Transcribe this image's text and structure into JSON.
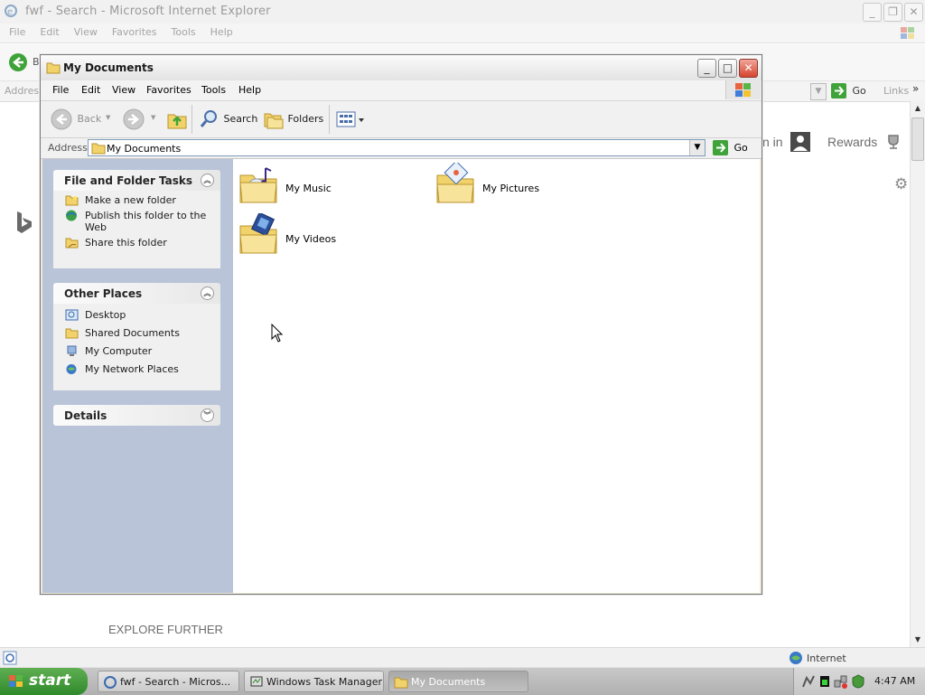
{
  "ie": {
    "title": "fwf - Search - Microsoft Internet Explorer",
    "menu": [
      "File",
      "Edit",
      "View",
      "Favorites",
      "Tools",
      "Help"
    ],
    "back_label": "B",
    "address_label": "Address",
    "go_label": "Go",
    "links_label": "Links",
    "sign_in_text": "n in",
    "rewards_text": "Rewards",
    "explore_text": "EXPLORE FURTHER",
    "status_zone": "Internet"
  },
  "window": {
    "title": "My Documents",
    "menu": [
      "File",
      "Edit",
      "View",
      "Favorites",
      "Tools",
      "Help"
    ],
    "toolbar": {
      "back": "Back",
      "search": "Search",
      "folders": "Folders"
    },
    "address_label": "Address",
    "address_value": "My Documents",
    "go_label": "Go",
    "panels": {
      "file_tasks": {
        "title": "File and Folder Tasks",
        "items": [
          "Make a new folder",
          "Publish this folder to the Web",
          "Share this folder"
        ]
      },
      "other_places": {
        "title": "Other Places",
        "items": [
          "Desktop",
          "Shared Documents",
          "My Computer",
          "My Network Places"
        ]
      },
      "details": {
        "title": "Details"
      }
    },
    "folders": [
      "My Music",
      "My Pictures",
      "My Videos"
    ]
  },
  "taskbar": {
    "start_label": "start",
    "buttons": [
      "fwf - Search - Micros...",
      "Windows Task Manager",
      "My Documents"
    ],
    "clock": "4:47 AM"
  },
  "colors": {
    "xp_green": "#2f8a2b",
    "close_red": "#d6432d",
    "address_border": "#7f9db9"
  }
}
